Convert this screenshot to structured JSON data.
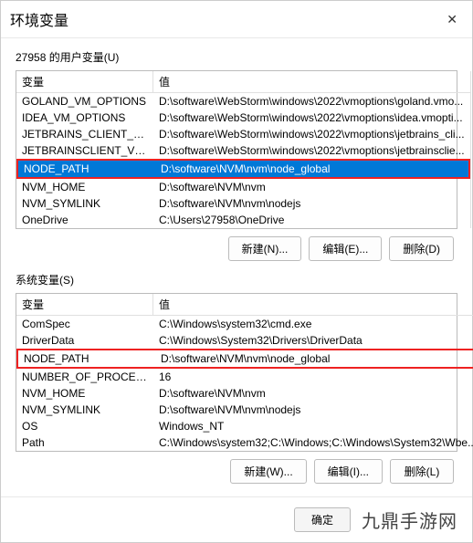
{
  "dialog": {
    "title": "环境变量"
  },
  "user": {
    "label": "27958 的用户变量(U)",
    "header_var": "变量",
    "header_val": "值",
    "rows": [
      {
        "var": "GOLAND_VM_OPTIONS",
        "val": "D:\\software\\WebStorm\\windows\\2022\\vmoptions\\goland.vmo...",
        "red": false,
        "selected": false
      },
      {
        "var": "IDEA_VM_OPTIONS",
        "val": "D:\\software\\WebStorm\\windows\\2022\\vmoptions\\idea.vmopti...",
        "red": false,
        "selected": false
      },
      {
        "var": "JETBRAINS_CLIENT_VM_O...",
        "val": "D:\\software\\WebStorm\\windows\\2022\\vmoptions\\jetbrains_cli...",
        "red": false,
        "selected": false
      },
      {
        "var": "JETBRAINSCLIENT_VM_OP...",
        "val": "D:\\software\\WebStorm\\windows\\2022\\vmoptions\\jetbrainsclie...",
        "red": false,
        "selected": false
      },
      {
        "var": "NODE_PATH",
        "val": "D:\\software\\NVM\\nvm\\node_global",
        "red": true,
        "selected": true
      },
      {
        "var": "NVM_HOME",
        "val": "D:\\software\\NVM\\nvm",
        "red": false,
        "selected": false
      },
      {
        "var": "NVM_SYMLINK",
        "val": "D:\\software\\NVM\\nvm\\nodejs",
        "red": false,
        "selected": false
      },
      {
        "var": "OneDrive",
        "val": "C:\\Users\\27958\\OneDrive",
        "red": false,
        "selected": false
      }
    ],
    "buttons": {
      "new": "新建(N)...",
      "edit": "编辑(E)...",
      "del": "删除(D)"
    }
  },
  "system": {
    "label": "系统变量(S)",
    "header_var": "变量",
    "header_val": "值",
    "rows": [
      {
        "var": "ComSpec",
        "val": "C:\\Windows\\system32\\cmd.exe",
        "red": false
      },
      {
        "var": "DriverData",
        "val": "C:\\Windows\\System32\\Drivers\\DriverData",
        "red": false
      },
      {
        "var": "NODE_PATH",
        "val": "D:\\software\\NVM\\nvm\\node_global",
        "red": true
      },
      {
        "var": "NUMBER_OF_PROCESSORS",
        "val": "16",
        "red": false
      },
      {
        "var": "NVM_HOME",
        "val": "D:\\software\\NVM\\nvm",
        "red": false
      },
      {
        "var": "NVM_SYMLINK",
        "val": "D:\\software\\NVM\\nvm\\nodejs",
        "red": false
      },
      {
        "var": "OS",
        "val": "Windows_NT",
        "red": false
      },
      {
        "var": "Path",
        "val": "C:\\Windows\\system32;C:\\Windows;C:\\Windows\\System32\\Wbe...",
        "red": false
      }
    ],
    "buttons": {
      "new": "新建(W)...",
      "edit": "编辑(I)...",
      "del": "删除(L)"
    }
  },
  "footer": {
    "ok": "确定",
    "watermark": "九鼎手游网"
  }
}
